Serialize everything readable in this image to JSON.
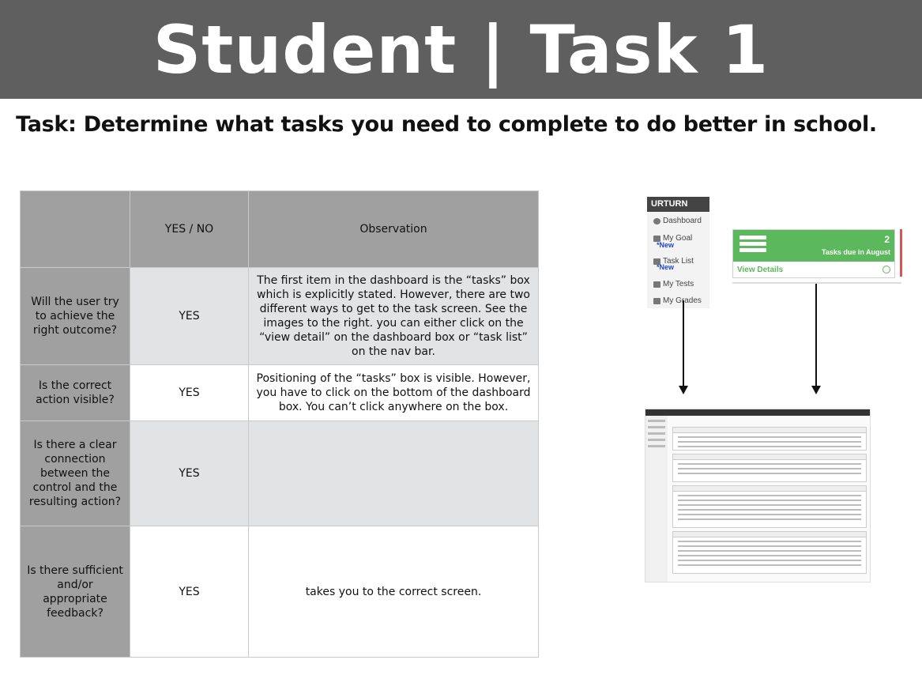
{
  "slide_title": "Student | Task 1",
  "task_prompt": "Task: Determine what tasks you need to complete to do better in school.",
  "table": {
    "headers": [
      "",
      "YES / NO",
      "Observation"
    ],
    "rows": [
      {
        "question": "Will the user try to achieve the right outcome?",
        "answer": "YES",
        "observation": "The first item in the dashboard is the “tasks” box which is explicitly stated. However, there are two different ways to get to the task screen. See the images to the right. you can either click on the “view detail” on the dashboard box or “task list” on the nav bar."
      },
      {
        "question": "Is the correct action visible?",
        "answer": "YES",
        "observation": "Positioning of the “tasks” box is visible. However, you have to click on the bottom of the dashboard box. You can’t click anywhere on the box."
      },
      {
        "question": "Is there a clear connection between the control and the resulting action?",
        "answer": "YES",
        "observation": ""
      },
      {
        "question": "Is there sufficient and/or appropriate feedback?",
        "answer": "YES",
        "observation": "takes you to the correct screen."
      }
    ]
  },
  "screenshot": {
    "brand": "URTURN",
    "nav_items": [
      "Dashboard",
      "My Goal",
      "Task List",
      "My Tests",
      "My Grades"
    ],
    "new_tag": "*New",
    "card_count": "2",
    "card_due_text": "Tasks due in August",
    "card_link": "View Details"
  },
  "colors": {
    "banner": "#5f5f5f",
    "header_cells": "#a0a0a0",
    "shaded_rows": "#e1e3e5",
    "card_green": "#5cb85c"
  }
}
